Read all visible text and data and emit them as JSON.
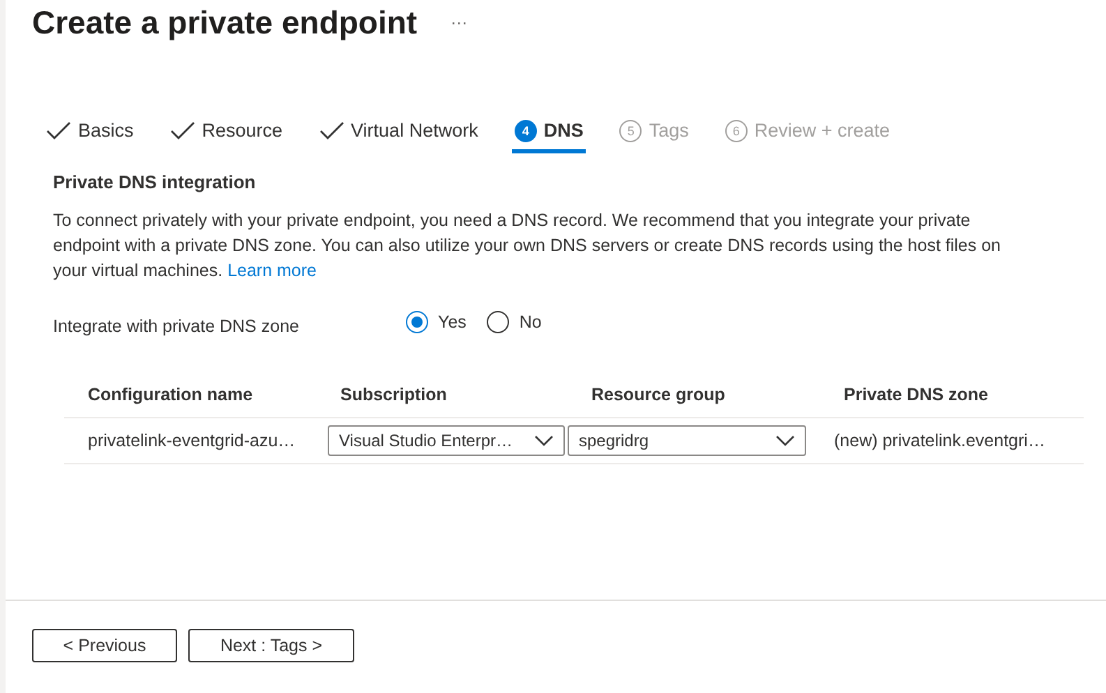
{
  "page": {
    "title": "Create a private endpoint",
    "more": "···"
  },
  "tabs": [
    {
      "label": "Basics",
      "kind": "done",
      "selected": false
    },
    {
      "label": "Resource",
      "kind": "done",
      "selected": false
    },
    {
      "label": "Virtual Network",
      "kind": "done",
      "selected": false
    },
    {
      "label": "DNS",
      "kind": "current",
      "step": "4",
      "selected": true
    },
    {
      "label": "Tags",
      "kind": "pending",
      "step": "5",
      "selected": false
    },
    {
      "label": "Review + create",
      "kind": "pending",
      "step": "6",
      "selected": false
    }
  ],
  "section": {
    "heading": "Private DNS integration",
    "description": "To connect privately with your private endpoint, you need a DNS record. We recommend that you integrate your private endpoint with a private DNS zone. You can also utilize your own DNS servers or create DNS records using the host files on your virtual machines.",
    "link": "Learn more"
  },
  "integrate": {
    "label": "Integrate with private DNS zone",
    "options": [
      {
        "label": "Yes",
        "selected": true
      },
      {
        "label": "No",
        "selected": false
      }
    ]
  },
  "table": {
    "columns": [
      "Configuration name",
      "Subscription",
      "Resource group",
      "Private DNS zone"
    ],
    "rows": [
      {
        "configuration_name": "privatelink-eventgrid-azu…",
        "subscription": "Visual Studio Enterpr…",
        "resource_group": "spegridrg",
        "private_dns_zone": "(new) privatelink.eventgri…"
      }
    ]
  },
  "footer": {
    "buttons": [
      "< Previous",
      "Next : Tags >"
    ]
  }
}
